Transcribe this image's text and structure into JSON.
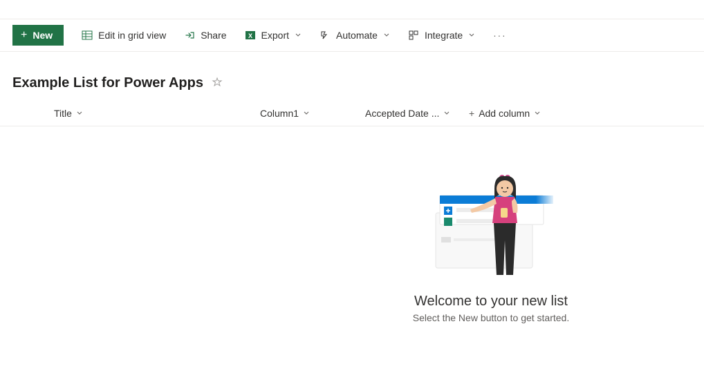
{
  "toolbar": {
    "new_label": "New",
    "edit_grid_label": "Edit in grid view",
    "share_label": "Share",
    "export_label": "Export",
    "automate_label": "Automate",
    "integrate_label": "Integrate"
  },
  "header": {
    "title": "Example List for Power Apps"
  },
  "columns": {
    "title_label": "Title",
    "column1_label": "Column1",
    "accepted_date_label": "Accepted Date ...",
    "add_column_label": "Add column"
  },
  "empty_state": {
    "title": "Welcome to your new list",
    "subtitle": "Select the New button to get started."
  }
}
